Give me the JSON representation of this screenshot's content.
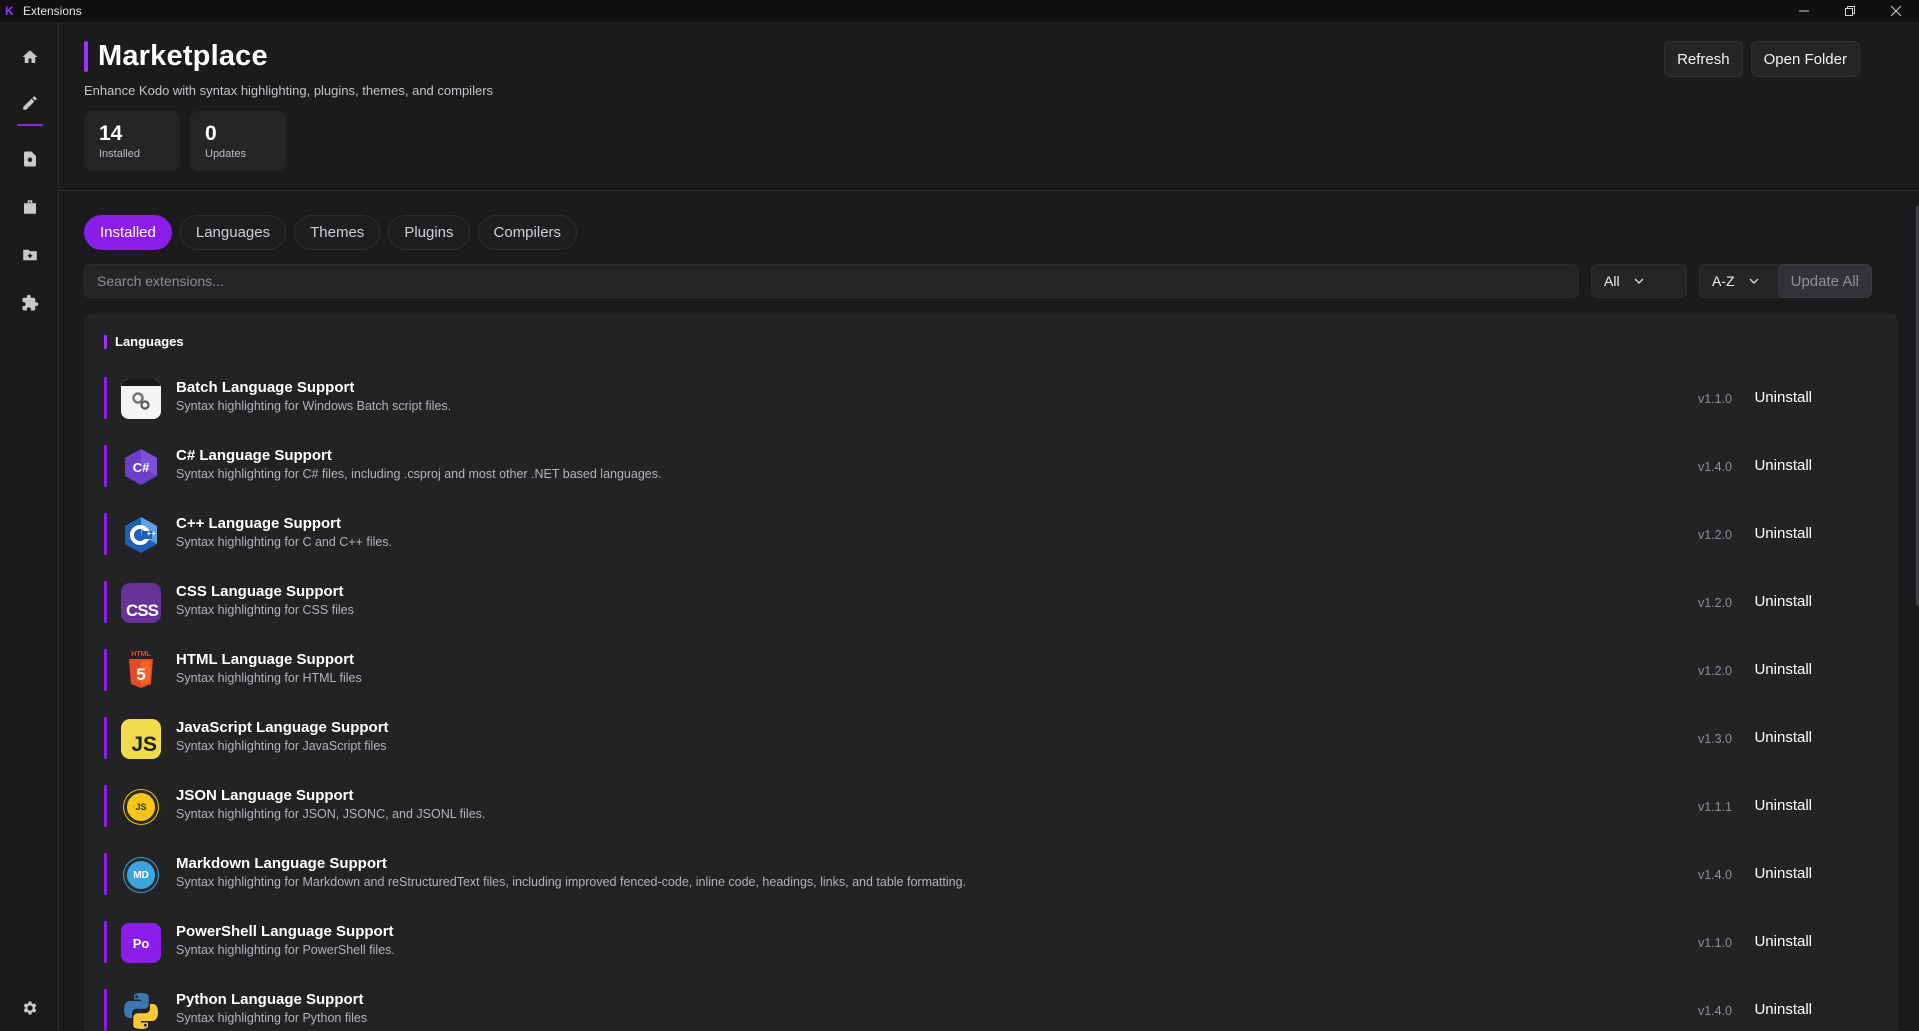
{
  "window": {
    "title": "Extensions"
  },
  "header": {
    "title": "Marketplace",
    "subtitle": "Enhance Kodo with syntax highlighting, plugins, themes, and compilers",
    "refresh_label": "Refresh",
    "open_folder_label": "Open Folder"
  },
  "stats": {
    "installed": {
      "value": "14",
      "label": "Installed"
    },
    "updates": {
      "value": "0",
      "label": "Updates"
    }
  },
  "tabs": [
    {
      "label": "Installed",
      "active": true
    },
    {
      "label": "Languages",
      "active": false
    },
    {
      "label": "Themes",
      "active": false
    },
    {
      "label": "Plugins",
      "active": false
    },
    {
      "label": "Compilers",
      "active": false
    }
  ],
  "search": {
    "placeholder": "Search extensions...",
    "value": ""
  },
  "filters": {
    "type": "All",
    "sort": "A-Z",
    "update_all_label": "Update All"
  },
  "list": {
    "section_title": "Languages",
    "items": [
      {
        "name": "Batch Language Support",
        "description": "Syntax highlighting for Windows Batch script files.",
        "version": "v1.1.0",
        "action": "Uninstall",
        "icon": "batch-icon"
      },
      {
        "name": "C# Language Support",
        "description": "Syntax highlighting for C# files, including .csproj and most other .NET based languages.",
        "version": "v1.4.0",
        "action": "Uninstall",
        "icon": "csharp-icon",
        "icon_text": "C#"
      },
      {
        "name": "C++ Language Support",
        "description": "Syntax highlighting for C and C++ files.",
        "version": "v1.2.0",
        "action": "Uninstall",
        "icon": "cpp-icon",
        "icon_text": "C++"
      },
      {
        "name": "CSS Language Support",
        "description": "Syntax highlighting for CSS files",
        "version": "v1.2.0",
        "action": "Uninstall",
        "icon": "css-icon",
        "icon_text": "CSS"
      },
      {
        "name": "HTML Language Support",
        "description": "Syntax highlighting for HTML files",
        "version": "v1.2.0",
        "action": "Uninstall",
        "icon": "html-icon",
        "icon_text": "5",
        "icon_caption": "HTML"
      },
      {
        "name": "JavaScript Language Support",
        "description": "Syntax highlighting for JavaScript files",
        "version": "v1.3.0",
        "action": "Uninstall",
        "icon": "javascript-icon",
        "icon_text": "JS"
      },
      {
        "name": "JSON Language Support",
        "description": "Syntax highlighting for JSON, JSONC, and JSONL files.",
        "version": "v1.1.1",
        "action": "Uninstall",
        "icon": "json-icon",
        "icon_text": "JS"
      },
      {
        "name": "Markdown Language Support",
        "description": "Syntax highlighting for Markdown and reStructuredText files, including improved fenced-code, inline code, headings, links, and table formatting.",
        "version": "v1.4.0",
        "action": "Uninstall",
        "icon": "markdown-icon",
        "icon_text": "MD"
      },
      {
        "name": "PowerShell Language Support",
        "description": "Syntax highlighting for PowerShell files.",
        "version": "v1.1.0",
        "action": "Uninstall",
        "icon": "powershell-icon",
        "icon_text": "Po"
      },
      {
        "name": "Python Language Support",
        "description": "Syntax highlighting for Python files",
        "version": "v1.4.0",
        "action": "Uninstall",
        "icon": "python-icon"
      }
    ]
  },
  "colors": {
    "accent": "#8a1ee8",
    "background": "#1b1b1d",
    "panel": "#232326"
  }
}
